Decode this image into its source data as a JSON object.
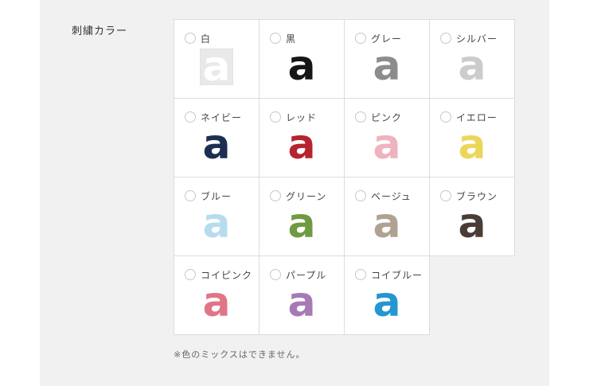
{
  "field": {
    "label": "刺繍カラー"
  },
  "options": [
    {
      "name": "白",
      "glyph": "a",
      "color": "#ffffff",
      "boxed": true
    },
    {
      "name": "黒",
      "glyph": "a",
      "color": "#161616"
    },
    {
      "name": "グレー",
      "glyph": "a",
      "color": "#8c8c8c"
    },
    {
      "name": "シルバー",
      "glyph": "a",
      "color": "#cccccc"
    },
    {
      "name": "ネイビー",
      "glyph": "a",
      "color": "#1c2f52"
    },
    {
      "name": "レッド",
      "glyph": "a",
      "color": "#b6242d"
    },
    {
      "name": "ピンク",
      "glyph": "a",
      "color": "#eeb3bd"
    },
    {
      "name": "イエロー",
      "glyph": "a",
      "color": "#ecd65a"
    },
    {
      "name": "ブルー",
      "glyph": "a",
      "color": "#b7dcef"
    },
    {
      "name": "グリーン",
      "glyph": "a",
      "color": "#6f9a42"
    },
    {
      "name": "ベージュ",
      "glyph": "a",
      "color": "#b0a291"
    },
    {
      "name": "ブラウン",
      "glyph": "a",
      "color": "#4a3d36"
    },
    {
      "name": "コイピンク",
      "glyph": "a",
      "color": "#e07588"
    },
    {
      "name": "パープル",
      "glyph": "a",
      "color": "#a57ab5"
    },
    {
      "name": "コイブルー",
      "glyph": "a",
      "color": "#2596cf"
    }
  ],
  "note": "※色のミックスはできません。"
}
